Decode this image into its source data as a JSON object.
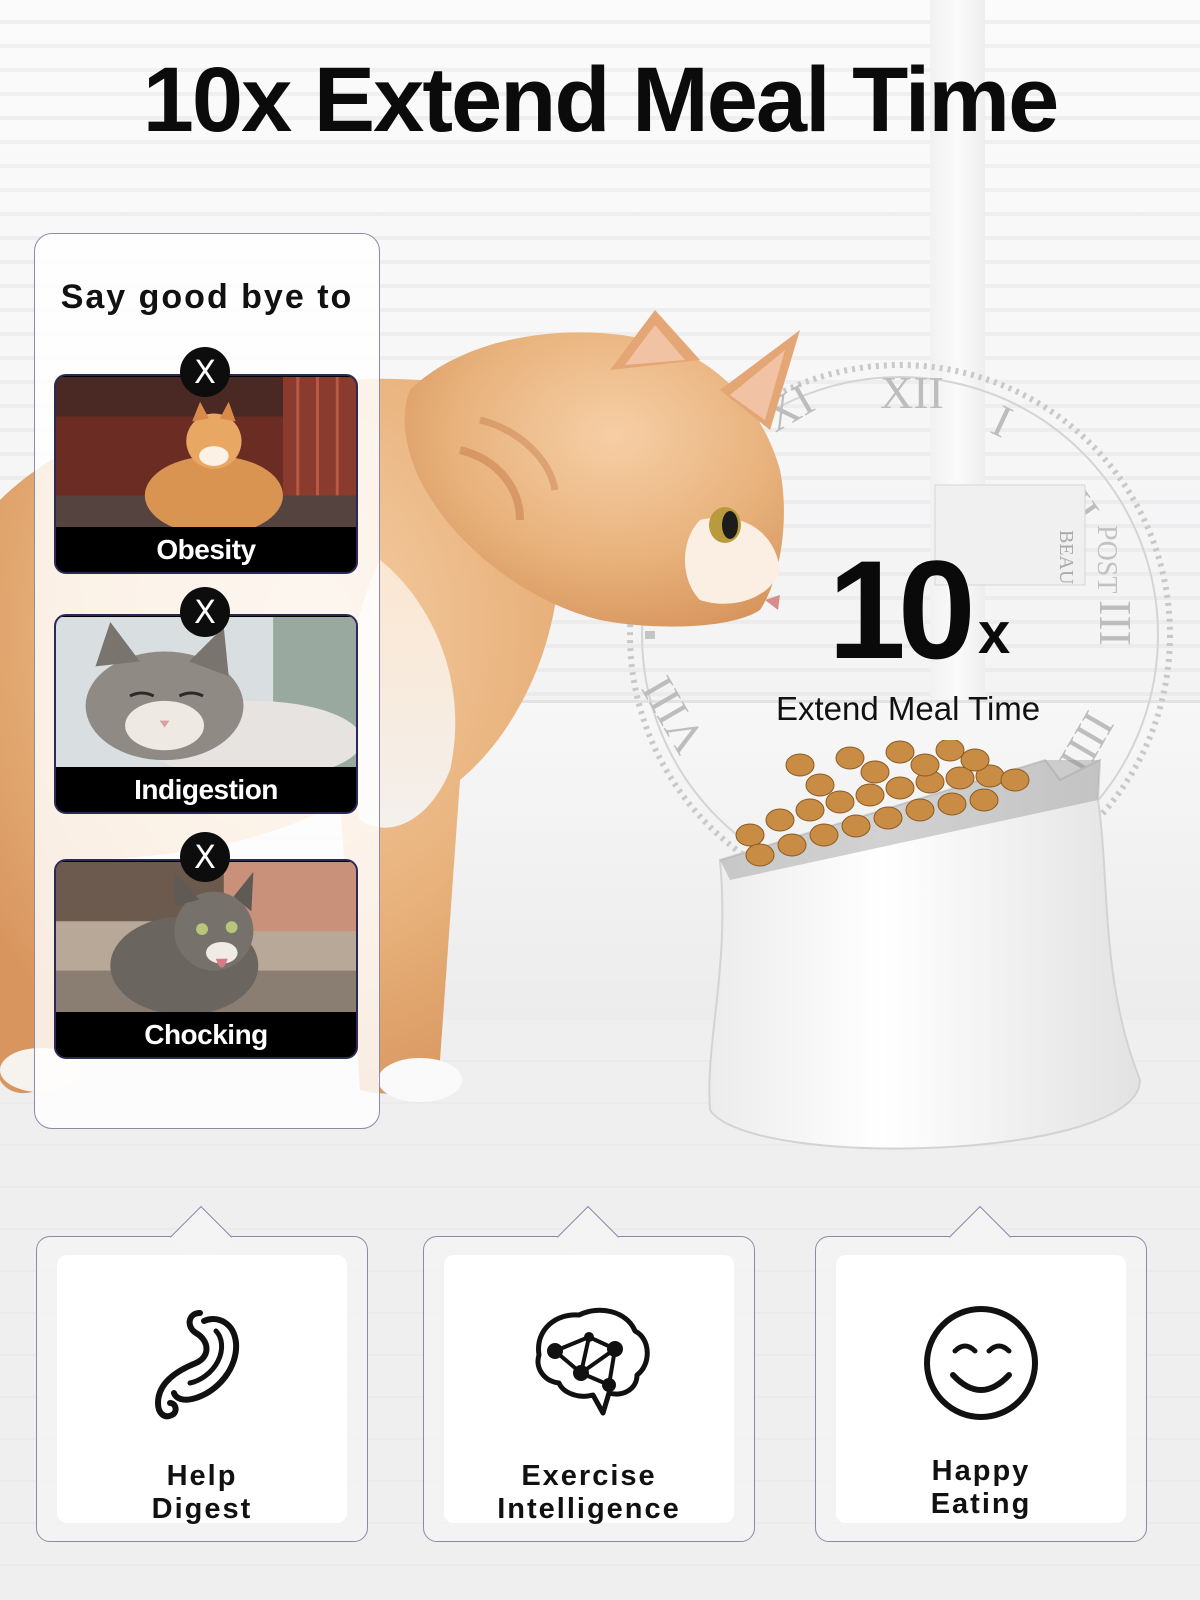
{
  "headline": "10x Extend Meal Time",
  "hero": {
    "number": "10",
    "multiplier": "x",
    "subtitle": "Extend Meal Time",
    "clock_numerals": [
      "XII",
      "I",
      "II",
      "III",
      "IIII",
      "VIII",
      "XI"
    ],
    "box_text": [
      "BEAU",
      "POST"
    ]
  },
  "say_panel": {
    "title": "Say good bye to",
    "badge_glyph": "X",
    "items": [
      {
        "label": "Obesity"
      },
      {
        "label": "Indigestion"
      },
      {
        "label": "Chocking"
      }
    ]
  },
  "benefits": [
    {
      "line1": "Help",
      "line2": "Digest",
      "icon": "stomach-icon"
    },
    {
      "line1": "Exercise",
      "line2": "Intelligence",
      "icon": "brain-icon"
    },
    {
      "line1": "Happy",
      "line2": "Eating",
      "icon": "smiley-icon"
    }
  ],
  "colors": {
    "panel_border": "#8d8aa8",
    "card_border": "#2b2a55",
    "text": "#0b0b0b",
    "cat_fur": "#e8b27c"
  }
}
